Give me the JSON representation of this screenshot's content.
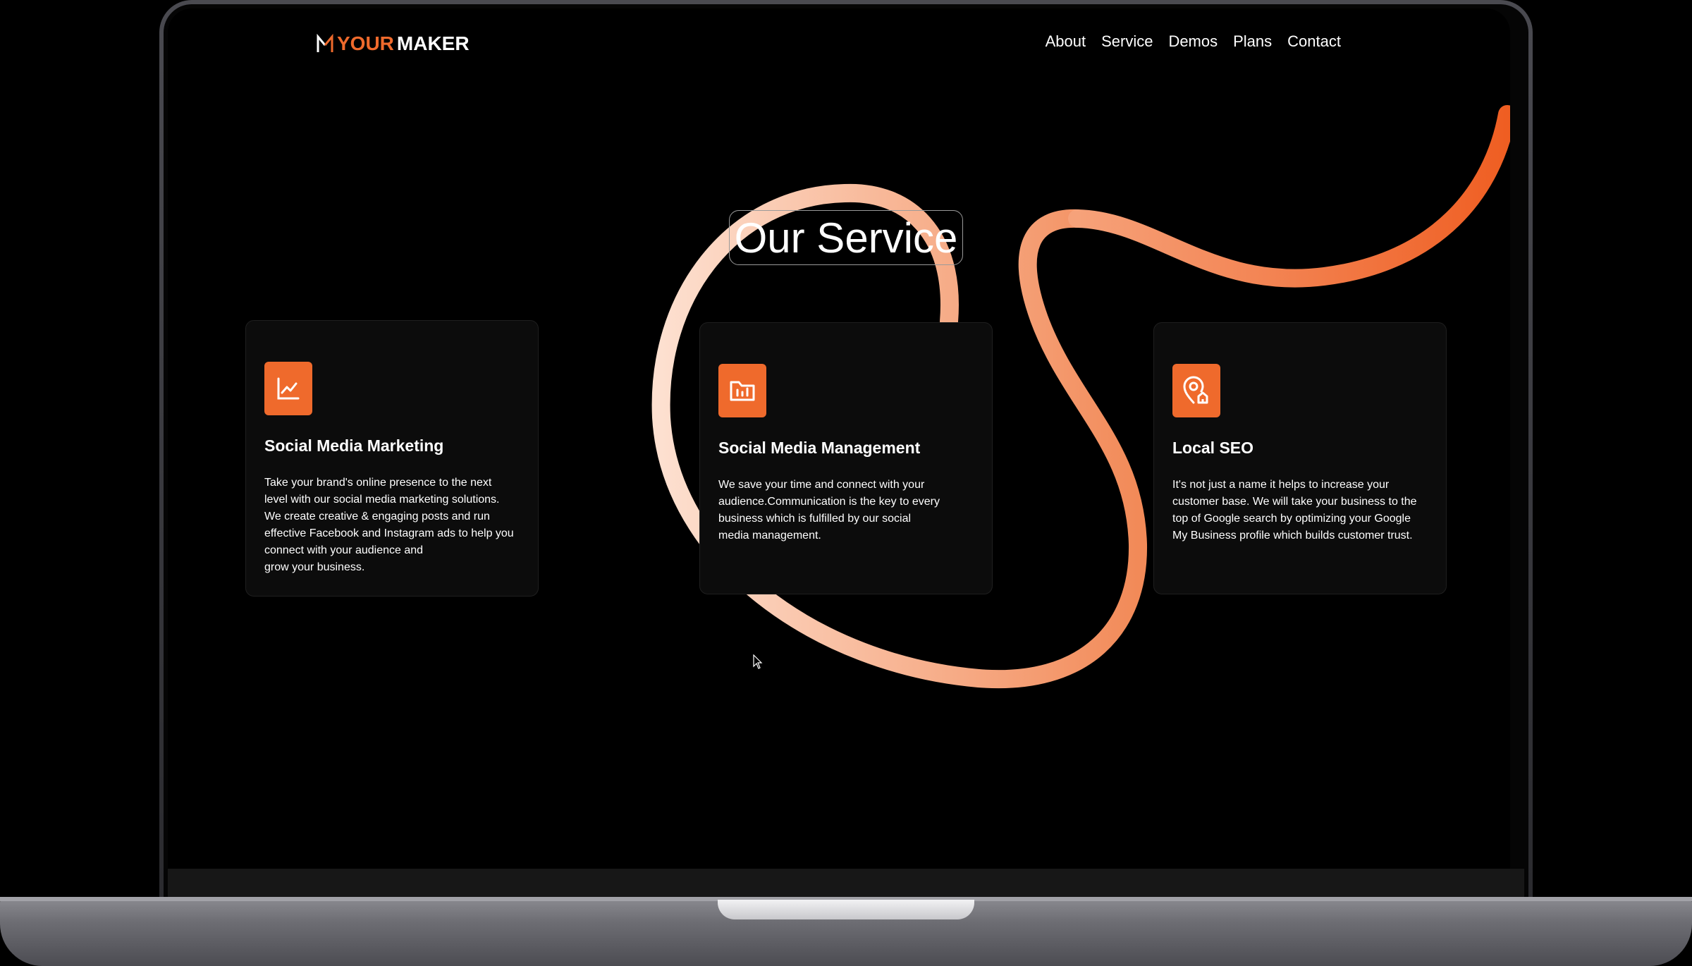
{
  "brand": {
    "logo_your": "YOUR",
    "logo_maker": "MAKER",
    "accent_color": "#ef6a2c"
  },
  "nav": {
    "items": [
      "About",
      "Service",
      "Demos",
      "Plans",
      "Contact"
    ]
  },
  "section": {
    "title": "Our Service"
  },
  "services": [
    {
      "icon": "line-chart-icon",
      "title": "Social Media Marketing",
      "lines": [
        "Take your brand's online presence to the next",
        "level with our social media marketing solutions.",
        "We create creative & engaging posts and run",
        "effective Facebook and Instagram ads to help you",
        "connect with your audience and",
        "grow your business."
      ]
    },
    {
      "icon": "folder-chart-icon",
      "title": "Social Media Management",
      "lines": [
        "We save your time and connect with your",
        "audience.Communication is the key to every",
        "business which is fulfilled by our social",
        "media management."
      ]
    },
    {
      "icon": "location-home-icon",
      "title": "Local SEO",
      "lines": [
        "It's not just a name it helps to increase your",
        "customer base. We will take your business to the",
        "top of Google search by optimizing your Google",
        "My Business profile which builds customer trust."
      ]
    }
  ]
}
